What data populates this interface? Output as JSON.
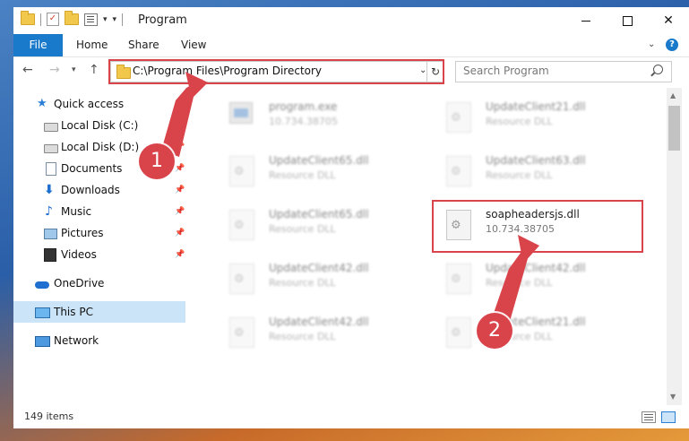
{
  "window": {
    "title": "Program",
    "controls": [
      "minimize",
      "maximize",
      "close"
    ]
  },
  "ribbon": {
    "tabs": [
      {
        "label": "File",
        "active": true
      },
      {
        "label": "Home"
      },
      {
        "label": "Share"
      },
      {
        "label": "View"
      }
    ]
  },
  "address": {
    "path": "C:\\Program Files\\Program Directory"
  },
  "search": {
    "placeholder": "Search Program"
  },
  "sidebar": {
    "items": [
      {
        "label": "Quick access",
        "icon": "star-icon",
        "pinned": false
      },
      {
        "label": "Local Disk (C:)",
        "icon": "disk-icon",
        "pinned": true
      },
      {
        "label": "Local Disk (D:)",
        "icon": "disk-icon",
        "pinned": true
      },
      {
        "label": "Documents",
        "icon": "document-icon",
        "pinned": true
      },
      {
        "label": "Downloads",
        "icon": "download-icon",
        "pinned": true
      },
      {
        "label": "Music",
        "icon": "music-icon",
        "pinned": true
      },
      {
        "label": "Pictures",
        "icon": "pictures-icon",
        "pinned": true
      },
      {
        "label": "Videos",
        "icon": "video-icon",
        "pinned": true
      },
      {
        "label": "OneDrive",
        "icon": "cloud-icon"
      },
      {
        "label": "This PC",
        "icon": "computer-icon",
        "selected": true
      },
      {
        "label": "Network",
        "icon": "network-icon"
      }
    ]
  },
  "files": [
    {
      "name": "program.exe",
      "sub": "10.734.38705",
      "blurred": true,
      "type": "exe"
    },
    {
      "name": "UpdateClient21.dll",
      "sub": "Resource DLL",
      "blurred": true
    },
    {
      "name": "UpdateClient65.dll",
      "sub": "Resource DLL",
      "blurred": true
    },
    {
      "name": "UpdateClient63.dll",
      "sub": "Resource DLL",
      "blurred": true
    },
    {
      "name": "UpdateClient65.dll",
      "sub": "Resource DLL",
      "blurred": true
    },
    {
      "name": "soapheadersjs.dll",
      "sub": "10.734.38705",
      "blurred": false
    },
    {
      "name": "UpdateClient42.dll",
      "sub": "Resource DLL",
      "blurred": true
    },
    {
      "name": "UpdateClient42.dll",
      "sub": "Resource DLL",
      "blurred": true
    },
    {
      "name": "UpdateClient42.dll",
      "sub": "Resource DLL",
      "blurred": true
    },
    {
      "name": "UpdateClient21.dll",
      "sub": "Resource DLL",
      "blurred": true
    }
  ],
  "status": {
    "count": "149 items"
  },
  "annotations": {
    "step1": "1",
    "step2": "2",
    "color": "#d9434a"
  }
}
